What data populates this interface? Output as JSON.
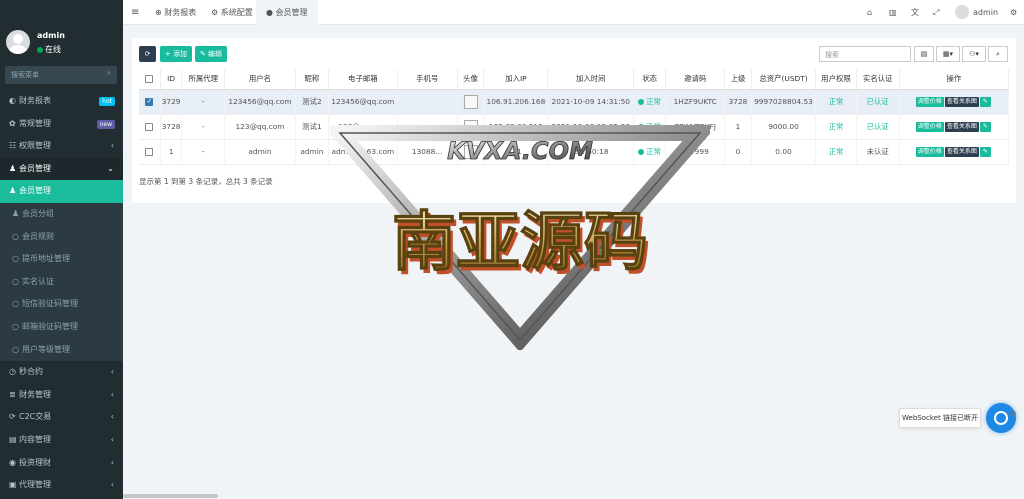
{
  "sidebar": {
    "user": {
      "name": "admin",
      "status": "在线"
    },
    "search_placeholder": "搜索菜单",
    "items": [
      {
        "label": "财务报表",
        "icon": "dashboard-icon",
        "badge": "hot",
        "badge_color": "#00c0ef",
        "type": "main"
      },
      {
        "label": "常规管理",
        "icon": "cogs-icon",
        "badge": "new",
        "badge_color": "#605ca8",
        "type": "main"
      },
      {
        "label": "权限管理",
        "icon": "group-icon",
        "arrow": "‹",
        "type": "main"
      },
      {
        "label": "会员管理",
        "icon": "user-icon",
        "arrow": "⌄",
        "type": "open"
      },
      {
        "label": "会员管理",
        "icon": "user-icon",
        "type": "active"
      },
      {
        "label": "会员分组",
        "icon": "users-icon",
        "type": "sub"
      },
      {
        "label": "会员规则",
        "icon": "circle-icon",
        "type": "sub"
      },
      {
        "label": "提币地址管理",
        "icon": "circle-icon",
        "type": "sub"
      },
      {
        "label": "实名认证",
        "icon": "circle-icon",
        "type": "sub"
      },
      {
        "label": "短信验证码管理",
        "icon": "circle-icon",
        "type": "sub"
      },
      {
        "label": "邮箱验证码管理",
        "icon": "circle-icon",
        "type": "sub"
      },
      {
        "label": "用户等级管理",
        "icon": "circle-icon",
        "type": "sub"
      },
      {
        "label": "秒合约",
        "icon": "clock-icon",
        "arrow": "‹",
        "type": "main"
      },
      {
        "label": "财务管理",
        "icon": "database-icon",
        "arrow": "‹",
        "type": "main"
      },
      {
        "label": "C2C交易",
        "icon": "refresh-icon",
        "arrow": "‹",
        "type": "main"
      },
      {
        "label": "内容管理",
        "icon": "file-icon",
        "arrow": "‹",
        "type": "main"
      },
      {
        "label": "投资理财",
        "icon": "money-icon",
        "arrow": "‹",
        "type": "main"
      },
      {
        "label": "代理管理",
        "icon": "briefcase-icon",
        "arrow": "‹",
        "type": "main"
      }
    ]
  },
  "topbar": {
    "tabs": [
      {
        "label": "财务报表",
        "icon": "dashboard-icon"
      },
      {
        "label": "系统配置",
        "icon": "gear-icon"
      },
      {
        "label": "会员管理",
        "icon": "user-icon"
      }
    ],
    "right_user": "admin"
  },
  "toolbar": {
    "refresh": "⟳",
    "add": "+ 添加",
    "edit": "✎ 编辑",
    "search_placeholder": "搜索"
  },
  "table": {
    "headers": [
      "",
      "ID",
      "所属代理",
      "用户名",
      "昵称",
      "电子邮箱",
      "手机号",
      "头像",
      "加入IP",
      "加入时间",
      "状态",
      "邀请码",
      "上级",
      "总资产(USDT)",
      "用户权限",
      "实名认证",
      "操作"
    ],
    "rows": [
      {
        "checked": true,
        "id": "3729",
        "agent": "-",
        "username": "123456@qq.com",
        "nickname": "测试2",
        "email": "123456@qq.com",
        "phone": "",
        "ip": "106.91.206.168",
        "time": "2021-10-09 14:31:50",
        "status": "正常",
        "invite": "1HZF9UKTC",
        "parent": "3728",
        "assets": "9997028804.53",
        "perm": "正常",
        "realname": "已认证"
      },
      {
        "checked": false,
        "id": "3728",
        "agent": "-",
        "username": "123@qq.com",
        "nickname": "测试1",
        "email": "123@qq.com",
        "phone": "",
        "ip": "125.83.86.215",
        "time": "2021-10-08 15:35:06",
        "status": "正常",
        "invite": "7PWYTEXFJ",
        "parent": "1",
        "assets": "9000.00",
        "perm": "正常",
        "realname": "已认证"
      },
      {
        "checked": false,
        "id": "1",
        "agent": "-",
        "username": "admin",
        "nickname": "admin",
        "email": "admin@163.com",
        "phone": "13088...",
        "ip": "...1",
        "time": "2...:50:18",
        "status": "正常",
        "invite": "vvv999",
        "parent": "0",
        "assets": "0.00",
        "perm": "正常",
        "realname": "未认证"
      }
    ],
    "ops": {
      "adjust": "调整价格",
      "relations": "查看关系图"
    }
  },
  "pager": "显示第 1 到第 3 条记录，总共 3 条记录",
  "watermark": {
    "url": "KVXA.COM",
    "title": "南亚源码"
  },
  "ws_tip": "WebSocket 链接已断开"
}
